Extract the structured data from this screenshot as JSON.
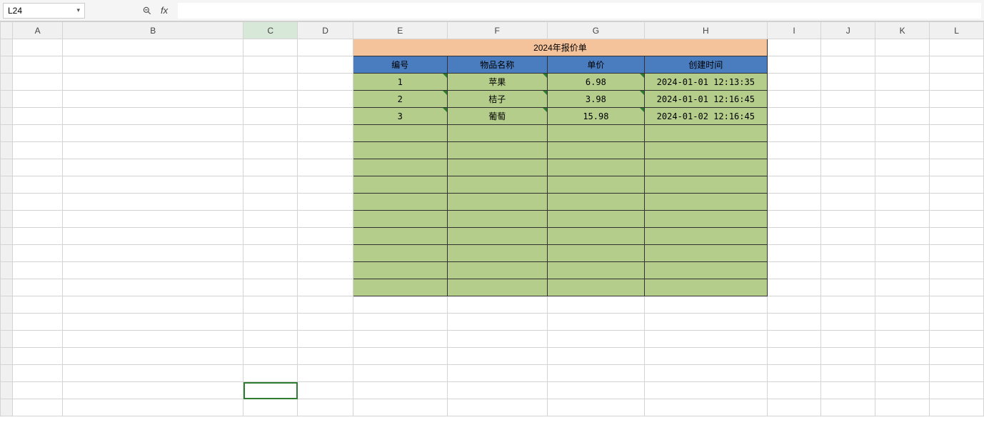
{
  "nameBox": {
    "value": "L24"
  },
  "formulaBar": {
    "fxLabel": "fx",
    "value": ""
  },
  "columns": [
    "A",
    "B",
    "C",
    "D",
    "E",
    "F",
    "G",
    "H",
    "I",
    "J",
    "K",
    "L"
  ],
  "table": {
    "title": "2024年报价单",
    "headers": [
      "编号",
      "物品名称",
      "单价",
      "创建时间"
    ],
    "rows": [
      {
        "id": "1",
        "name": "苹果",
        "price": "6.98",
        "created": "2024-01-01 12:13:35"
      },
      {
        "id": "2",
        "name": "桔子",
        "price": "3.98",
        "created": "2024-01-01 12:16:45"
      },
      {
        "id": "3",
        "name": "葡萄",
        "price": "15.98",
        "created": "2024-01-02 12:16:45"
      }
    ],
    "emptyRows": 10
  },
  "chart_data": {
    "type": "table",
    "title": "2024年报价单",
    "columns": [
      "编号",
      "物品名称",
      "单价",
      "创建时间"
    ],
    "rows": [
      [
        1,
        "苹果",
        6.98,
        "2024-01-01 12:13:35"
      ],
      [
        2,
        "桔子",
        3.98,
        "2024-01-01 12:16:45"
      ],
      [
        3,
        "葡萄",
        15.98,
        "2024-01-02 12:16:45"
      ]
    ]
  },
  "selection": {
    "cell": "C21",
    "highlightedColumn": "C"
  }
}
